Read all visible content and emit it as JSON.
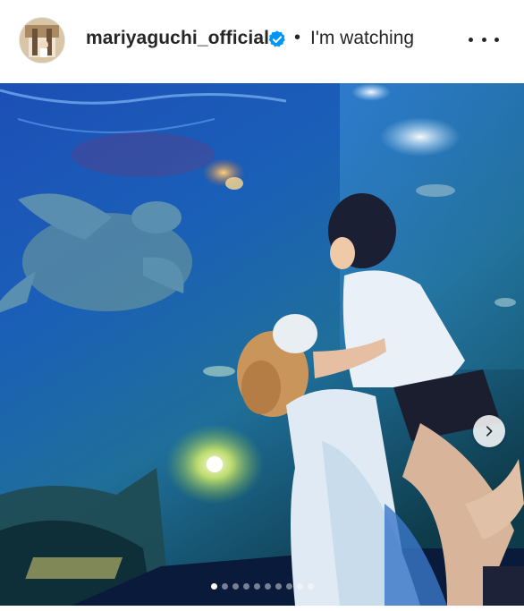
{
  "post": {
    "username": "mariyaguchi_official",
    "verified": true,
    "separator": "•",
    "follow_status": "I'm watching",
    "more_icon": "more-horizontal-icon",
    "next_icon": "chevron-right-icon",
    "carousel": {
      "total": 10,
      "current": 1
    }
  },
  "colors": {
    "text": "#262626",
    "verified_badge": "#0095f6",
    "water_deep": "#0b2f6e",
    "water_light": "#2f7fd0"
  }
}
